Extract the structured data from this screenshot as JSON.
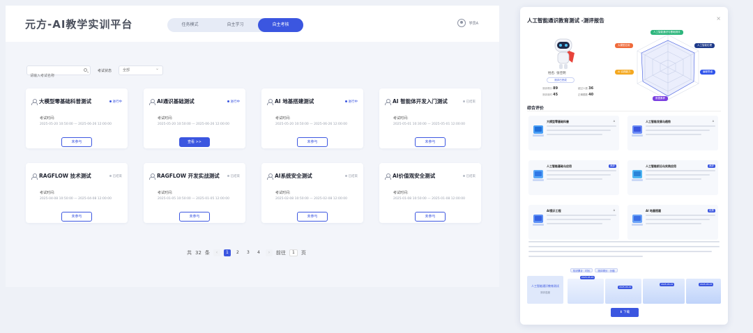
{
  "app": {
    "logo": "元方-AI教学实训平台",
    "modes": [
      "任务模式",
      "自主学习",
      "自主考核"
    ],
    "active_mode": 2,
    "user_name": "学员A"
  },
  "filters": {
    "search_placeholder": "请输入考试名称",
    "status_label": "考试状态",
    "status_value": "全部"
  },
  "cards": [
    {
      "title": "大模型零基础科普测试",
      "status": "进行中",
      "label": "考试时间:",
      "time": "2025-05-20  10:50:00  —  2025-06-26  12:00:00",
      "button": "未参与",
      "btn_primary": false,
      "ended": false
    },
    {
      "title": "AI通识基础测试",
      "status": "进行中",
      "label": "考试时间:",
      "time": "2025-05-20  10:50:00  —  2025-06-26  12:00:00",
      "button": "查看 >>",
      "btn_primary": true,
      "ended": false
    },
    {
      "title": "AI 地基搭建测试",
      "status": "进行中",
      "label": "考试时间:",
      "time": "2025-05-20  10:50:00  —  2025-06-26  12:00:00",
      "button": "未参与",
      "btn_primary": false,
      "ended": false
    },
    {
      "title": "AI 智能体开发入门测试",
      "status": "已结束",
      "label": "考试时间:",
      "time": "2025-05-01  10:30:00  —  2025-05-01  12:00:00",
      "button": "未参与",
      "btn_primary": false,
      "ended": true
    },
    {
      "title": "RAGFLOW 技术测试",
      "status": "已结束",
      "label": "考试时间:",
      "time": "2025-04-08  10:50:00  —  2025-04-08  12:00:00",
      "button": "未参与",
      "btn_primary": false,
      "ended": true
    },
    {
      "title": "RAGFLOW 开发实战测试",
      "status": "已结束",
      "label": "考试时间:",
      "time": "2025-01-05  10:50:00  —  2025-01-05  12:00:00",
      "button": "未参与",
      "btn_primary": false,
      "ended": true
    },
    {
      "title": "AI系统安全测试",
      "status": "已结束",
      "label": "考试时间:",
      "time": "2025-02-08  10:50:00  —  2025-02-08  12:00:00",
      "button": "未参与",
      "btn_primary": false,
      "ended": true
    },
    {
      "title": "AI价值观安全测试",
      "status": "已结束",
      "label": "考试时间:",
      "time": "2025-01-08  10:50:00  —  2025-01-08  12:00:00",
      "button": "未参与",
      "btn_primary": false,
      "ended": true
    }
  ],
  "pagination": {
    "total_prefix": "共",
    "total": "32",
    "total_suffix": "条",
    "pages": [
      "1",
      "2",
      "3",
      "4"
    ],
    "current": "1",
    "goto_label": "前往",
    "goto_value": "1",
    "goto_suffix": "页"
  },
  "report": {
    "title": "人工智能通识教育测试 -测评报告",
    "close": "×",
    "student_name": "姓名: 张佳明",
    "tag": "测评已完成",
    "stats": [
      {
        "label": "测评得分",
        "value": "89"
      },
      {
        "label": "超过人数",
        "value": "36"
      },
      {
        "label": "测评用时",
        "value": "45"
      },
      {
        "label": "正确题数",
        "value": "40"
      }
    ],
    "radar_labels": [
      "人工智能通识与基础测评",
      "人工智能伦理",
      "大模型应用",
      "AI 实践能力",
      "编程思维",
      "数据素养"
    ],
    "section_title": "综合评价",
    "evaluations": [
      {
        "title": "大模型零基础科普",
        "grade": "A"
      },
      {
        "title": "人工智能发展与趋势",
        "grade": "A"
      },
      {
        "title": "人工智能基础与应用",
        "grade": "良好"
      },
      {
        "title": "人工智能前沿与实践应用",
        "grade": "良好"
      },
      {
        "title": "AI提示工程",
        "grade": "A"
      },
      {
        "title": "AI 地基搭建",
        "grade": "优秀"
      }
    ],
    "timeline": {
      "box_title": "人工智能通识教育测试",
      "box_sub": "测评进度",
      "toggles": [
        "知识累计 · 时长",
        "测评得分 · 分值"
      ],
      "points": [
        "2025-05-20",
        "2025-05-21",
        "2025-05-22",
        "2025-05-23"
      ]
    },
    "download": "⬇ 下载"
  },
  "colors": {
    "accent": "#3b56e0",
    "radar": [
      "#2eb67d",
      "#1e3a8a",
      "#ef6a3a",
      "#f4a820",
      "#7a3fe0",
      "#2f54eb"
    ]
  }
}
